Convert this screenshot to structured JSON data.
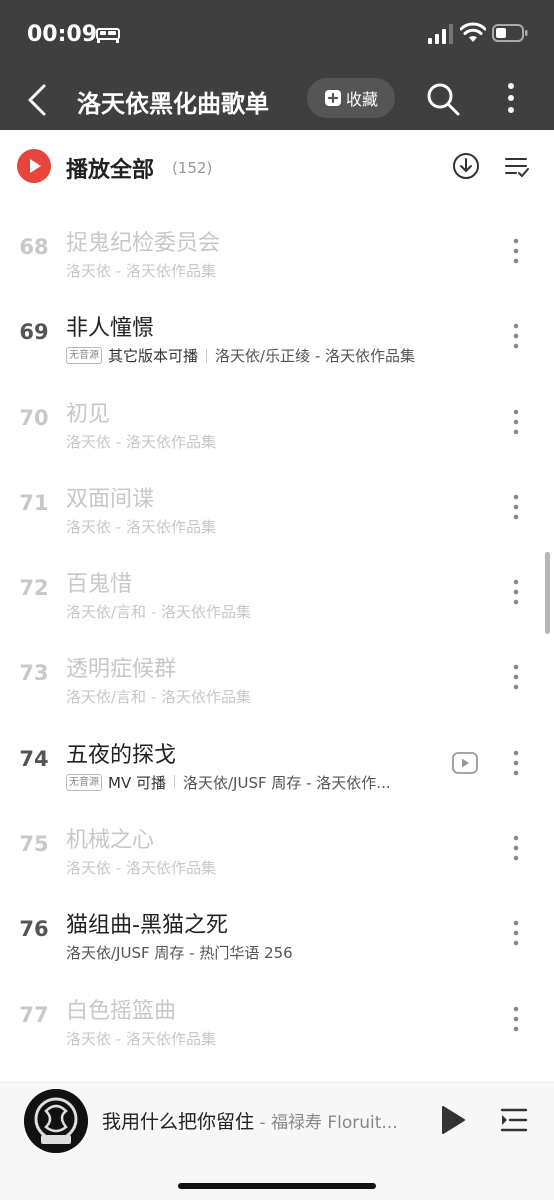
{
  "status_bar": {
    "time": "00:09"
  },
  "nav": {
    "title": "洛天依黑化曲歌单",
    "collect_label": "收藏"
  },
  "play_all": {
    "label": "播放全部",
    "count": "(152)"
  },
  "songs": [
    {
      "index": "68",
      "title": "捉鬼纪检委员会",
      "subtitle": "洛天依 - 洛天依作品集",
      "active": false
    },
    {
      "index": "69",
      "title": "非人憧憬",
      "badge": "无音源",
      "availability": "其它版本可播",
      "subtitle": "洛天依/乐正绫 - 洛天依作品集",
      "active": true
    },
    {
      "index": "70",
      "title": "初见",
      "subtitle": "洛天依 - 洛天依作品集",
      "active": false
    },
    {
      "index": "71",
      "title": "双面间谍",
      "subtitle": "洛天依 - 洛天依作品集",
      "active": false
    },
    {
      "index": "72",
      "title": "百鬼惜",
      "subtitle": "洛天依/言和 - 洛天依作品集",
      "active": false
    },
    {
      "index": "73",
      "title": "透明症候群",
      "subtitle": "洛天依/言和 - 洛天依作品集",
      "active": false
    },
    {
      "index": "74",
      "title": "五夜的探戈",
      "badge": "无音源",
      "availability": "MV 可播",
      "subtitle": "洛天依/JUSF 周存 - 洛天依作...",
      "active": true,
      "mv": true
    },
    {
      "index": "75",
      "title": "机械之心",
      "subtitle": "洛天依 - 洛天依作品集",
      "active": false
    },
    {
      "index": "76",
      "title": "猫组曲-黑猫之死",
      "subtitle": "洛天依/JUSF 周存 - 热门华语 256",
      "active": true
    },
    {
      "index": "77",
      "title": "白色摇篮曲",
      "subtitle": "洛天依 - 洛天依作品集",
      "active": false
    }
  ],
  "now_playing": {
    "title": "我用什么把你留住",
    "artist": " - 福禄寿 Floruit...",
    "album_text": "福禄寿"
  },
  "colors": {
    "header_bg": "#3f3f3f",
    "accent_red": "#e8453c",
    "inactive_text": "#c8c8c8"
  }
}
